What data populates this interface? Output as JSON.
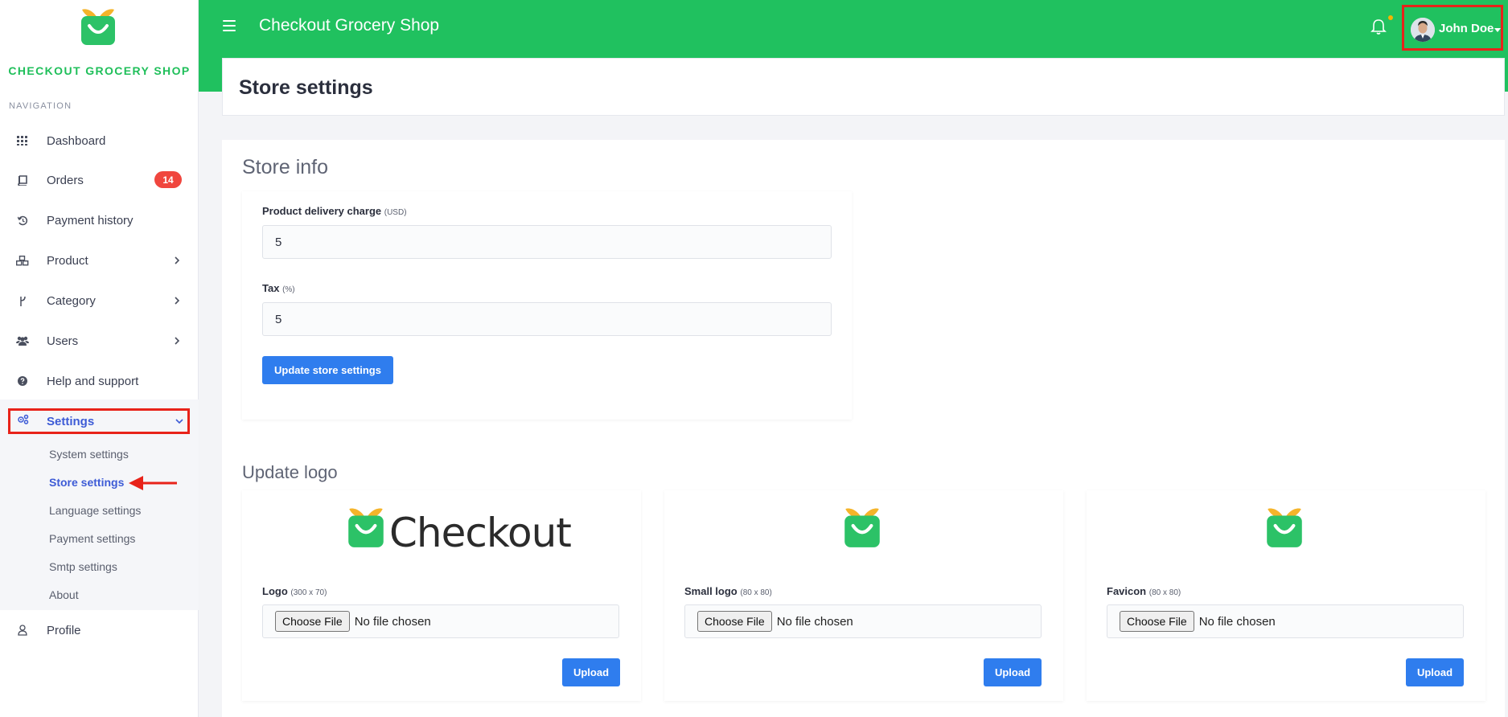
{
  "sidebar": {
    "brand_name": "CHECKOUT GROCERY SHOP",
    "nav_caption": "NAVIGATION",
    "items": [
      {
        "label": "Dashboard",
        "icon": "grid-icon"
      },
      {
        "label": "Orders",
        "icon": "book-icon",
        "badge": "14"
      },
      {
        "label": "Payment history",
        "icon": "history-icon"
      },
      {
        "label": "Product",
        "icon": "cubes-icon"
      },
      {
        "label": "Category",
        "icon": "branch-icon"
      },
      {
        "label": "Users",
        "icon": "users-icon"
      },
      {
        "label": "Help and support",
        "icon": "question-circle-icon"
      },
      {
        "label": "Settings",
        "icon": "gears-icon"
      },
      {
        "label": "Profile",
        "icon": "user-icon"
      }
    ],
    "settings_sub": [
      "System settings",
      "Store settings",
      "Language settings",
      "Payment settings",
      "Smtp settings",
      "About"
    ]
  },
  "topbar": {
    "title": "Checkout Grocery Shop",
    "user_name": "John Doe"
  },
  "page": {
    "title": "Store settings"
  },
  "store_info": {
    "title": "Store info",
    "delivery_label": "Product delivery charge",
    "delivery_unit": "(USD)",
    "delivery_value": "5",
    "tax_label": "Tax",
    "tax_unit": "(%)",
    "tax_value": "5",
    "update_button": "Update store settings"
  },
  "update_logo": {
    "title": "Update logo",
    "logo_word": "Checkout",
    "cards": [
      {
        "label": "Logo",
        "size": "(300 x 70)",
        "choose": "Choose File",
        "status": "No file chosen",
        "upload": "Upload"
      },
      {
        "label": "Small logo",
        "size": "(80 x 80)",
        "choose": "Choose File",
        "status": "No file chosen",
        "upload": "Upload"
      },
      {
        "label": "Favicon",
        "size": "(80 x 80)",
        "choose": "Choose File",
        "status": "No file chosen",
        "upload": "Upload"
      }
    ]
  },
  "colors": {
    "brand_green": "#20c15f",
    "accent_blue": "#2f7dee",
    "active_blue": "#3d5bd6",
    "badge_red": "#f0463e",
    "highlight_red": "#e8231a"
  }
}
